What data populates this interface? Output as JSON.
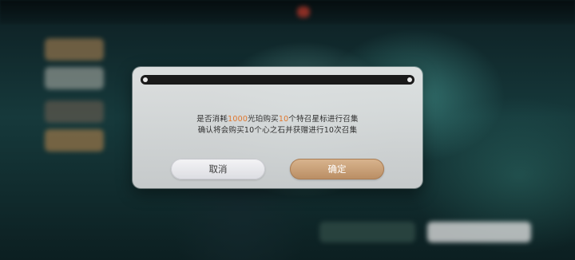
{
  "dialog": {
    "line1": {
      "part1": "是否消耗",
      "cost": "1000",
      "part2": "光珀购买",
      "count": "10",
      "part3": "个特召星标进行召集"
    },
    "line2": "确认将会购买10个心之石并获赠进行10次召集",
    "cancel_label": "取消",
    "confirm_label": "确定"
  },
  "colors": {
    "highlight": "#e0762c",
    "confirm_button": "#c79d74",
    "cancel_button": "#e8e9ec",
    "title_bar": "#1a1a1a"
  }
}
